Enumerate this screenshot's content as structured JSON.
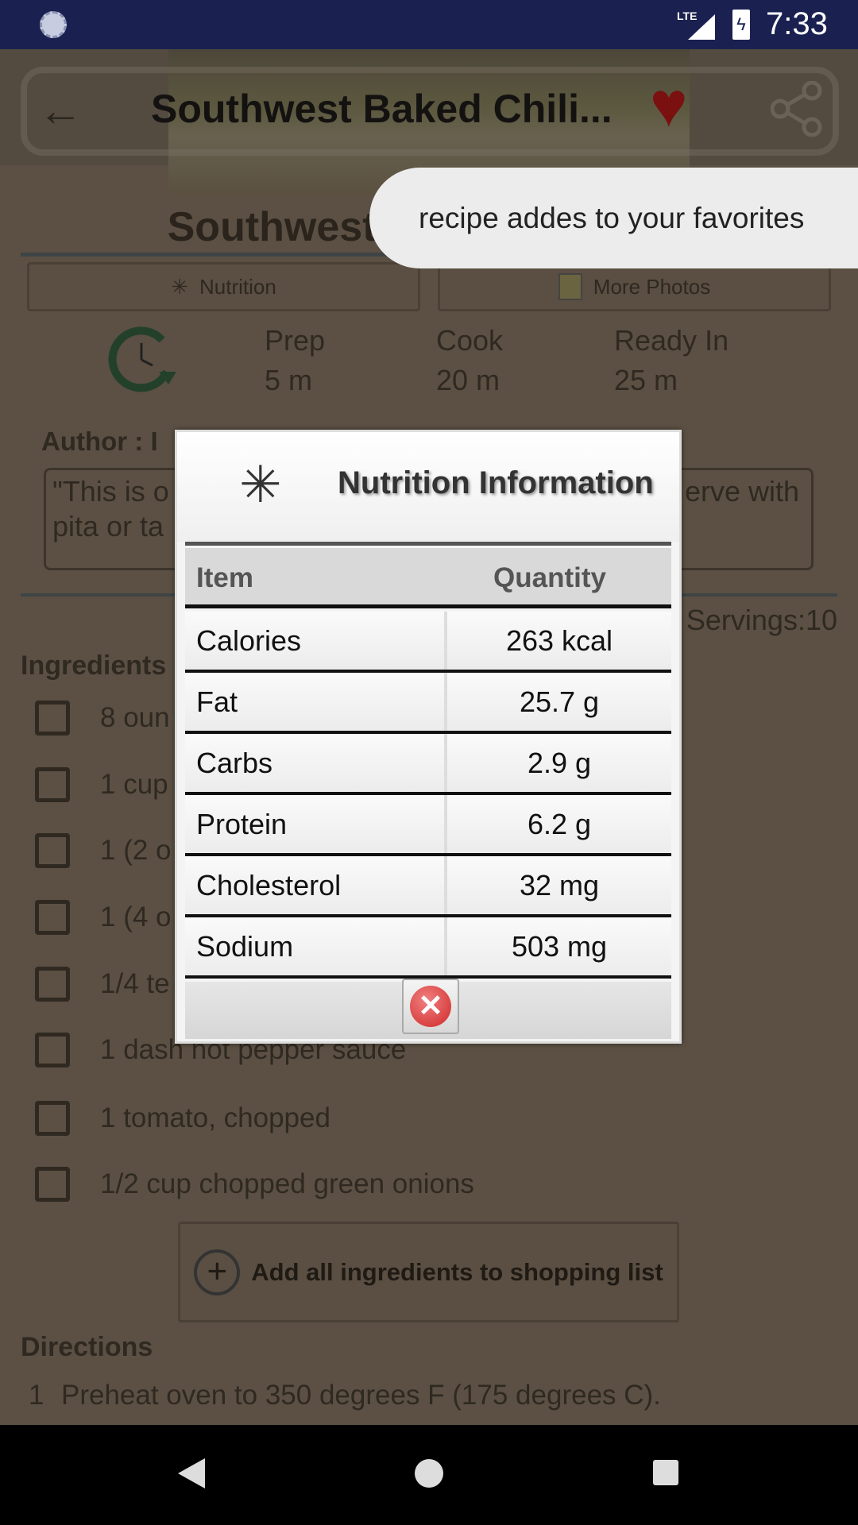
{
  "status_bar": {
    "time": "7:33",
    "network": "LTE"
  },
  "toolbar": {
    "title": "Southwest Baked Chili...",
    "icons": [
      "back-arrow-icon",
      "favorite-heart-icon",
      "share-icon"
    ]
  },
  "toast": {
    "message": "recipe addes to your favorites"
  },
  "recipe": {
    "title": "Southwest Baked Chili Dip",
    "nutrition_button": "Nutrition",
    "photos_button": "More Photos",
    "times": [
      {
        "label": "Prep",
        "value": "5 m"
      },
      {
        "label": "Cook",
        "value": "20 m"
      },
      {
        "label": "Ready In",
        "value": "25 m"
      }
    ],
    "author": "Author : I",
    "description_line1": "\"This is o",
    "description_line1_end": "erve with",
    "description_line2": "pita or ta",
    "servings": "Servings:10",
    "ingredients_heading": "Ingredients",
    "ingredients": [
      "8 oun",
      "1 cup",
      "1 (2 o",
      "1 (4 o",
      "1/4 te",
      "1 dash hot pepper sauce",
      "1 tomato, chopped",
      "1/2 cup chopped green onions"
    ],
    "add_all_button": "Add all ingredients to shopping list",
    "directions_heading": "Directions",
    "directions": [
      {
        "num": "1",
        "text": "Preheat oven to 350 degrees F (175 degrees C)."
      }
    ]
  },
  "dialog": {
    "title": "Nutrition Information",
    "headers": {
      "item": "Item",
      "quantity": "Quantity"
    },
    "rows": [
      {
        "item": "Calories",
        "quantity": "263 kcal"
      },
      {
        "item": "Fat",
        "quantity": "25.7 g"
      },
      {
        "item": "Carbs",
        "quantity": "2.9 g"
      },
      {
        "item": "Protein",
        "quantity": "6.2 g"
      },
      {
        "item": "Cholesterol",
        "quantity": "32 mg"
      },
      {
        "item": "Sodium",
        "quantity": "503 mg"
      }
    ],
    "close_icon": "close-x-icon"
  }
}
